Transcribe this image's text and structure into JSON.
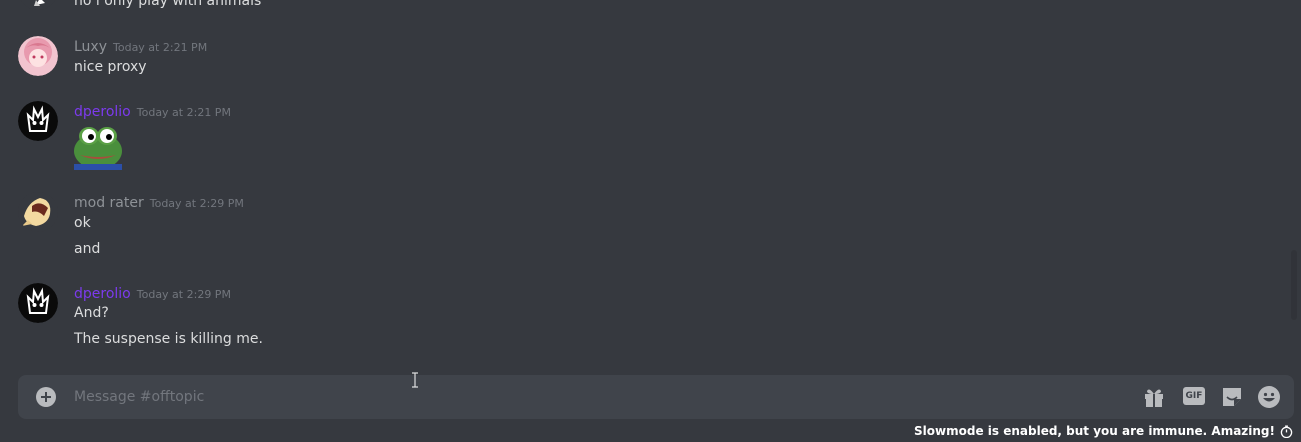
{
  "messages": [
    {
      "user": "",
      "time": "",
      "lines": [
        "no i only play with animals"
      ],
      "name_color": "#b9bbbe"
    },
    {
      "user": "Luxy",
      "time": "Today at 2:21 PM",
      "lines": [
        "nice proxy"
      ],
      "name_color": "#8e9297"
    },
    {
      "user": "dperolio",
      "time": "Today at 2:21 PM",
      "lines": [],
      "emoji": "pepe-frog-emote",
      "name_color": "#7c3aed"
    },
    {
      "user": "mod rater",
      "time": "Today at 2:29 PM",
      "lines": [
        "ok",
        "and"
      ],
      "name_color": "#8e9297"
    },
    {
      "user": "dperolio",
      "time": "Today at 2:29 PM",
      "lines": [
        "And?",
        "The suspense is killing me."
      ],
      "name_color": "#7c3aed"
    }
  ],
  "composer": {
    "placeholder": "Message #offtopic",
    "gif_label": "GIF",
    "icons": [
      "plus-circle-icon",
      "gift-icon",
      "gif-icon",
      "sticker-icon",
      "emoji-icon"
    ]
  },
  "slowmode": {
    "text": "Slowmode is enabled, but you are immune. Amazing!",
    "icon": "stopwatch-icon"
  },
  "colors": {
    "background": "#36393f",
    "input_bg": "#40444b",
    "text": "#dcddde",
    "muted": "#72767d"
  }
}
